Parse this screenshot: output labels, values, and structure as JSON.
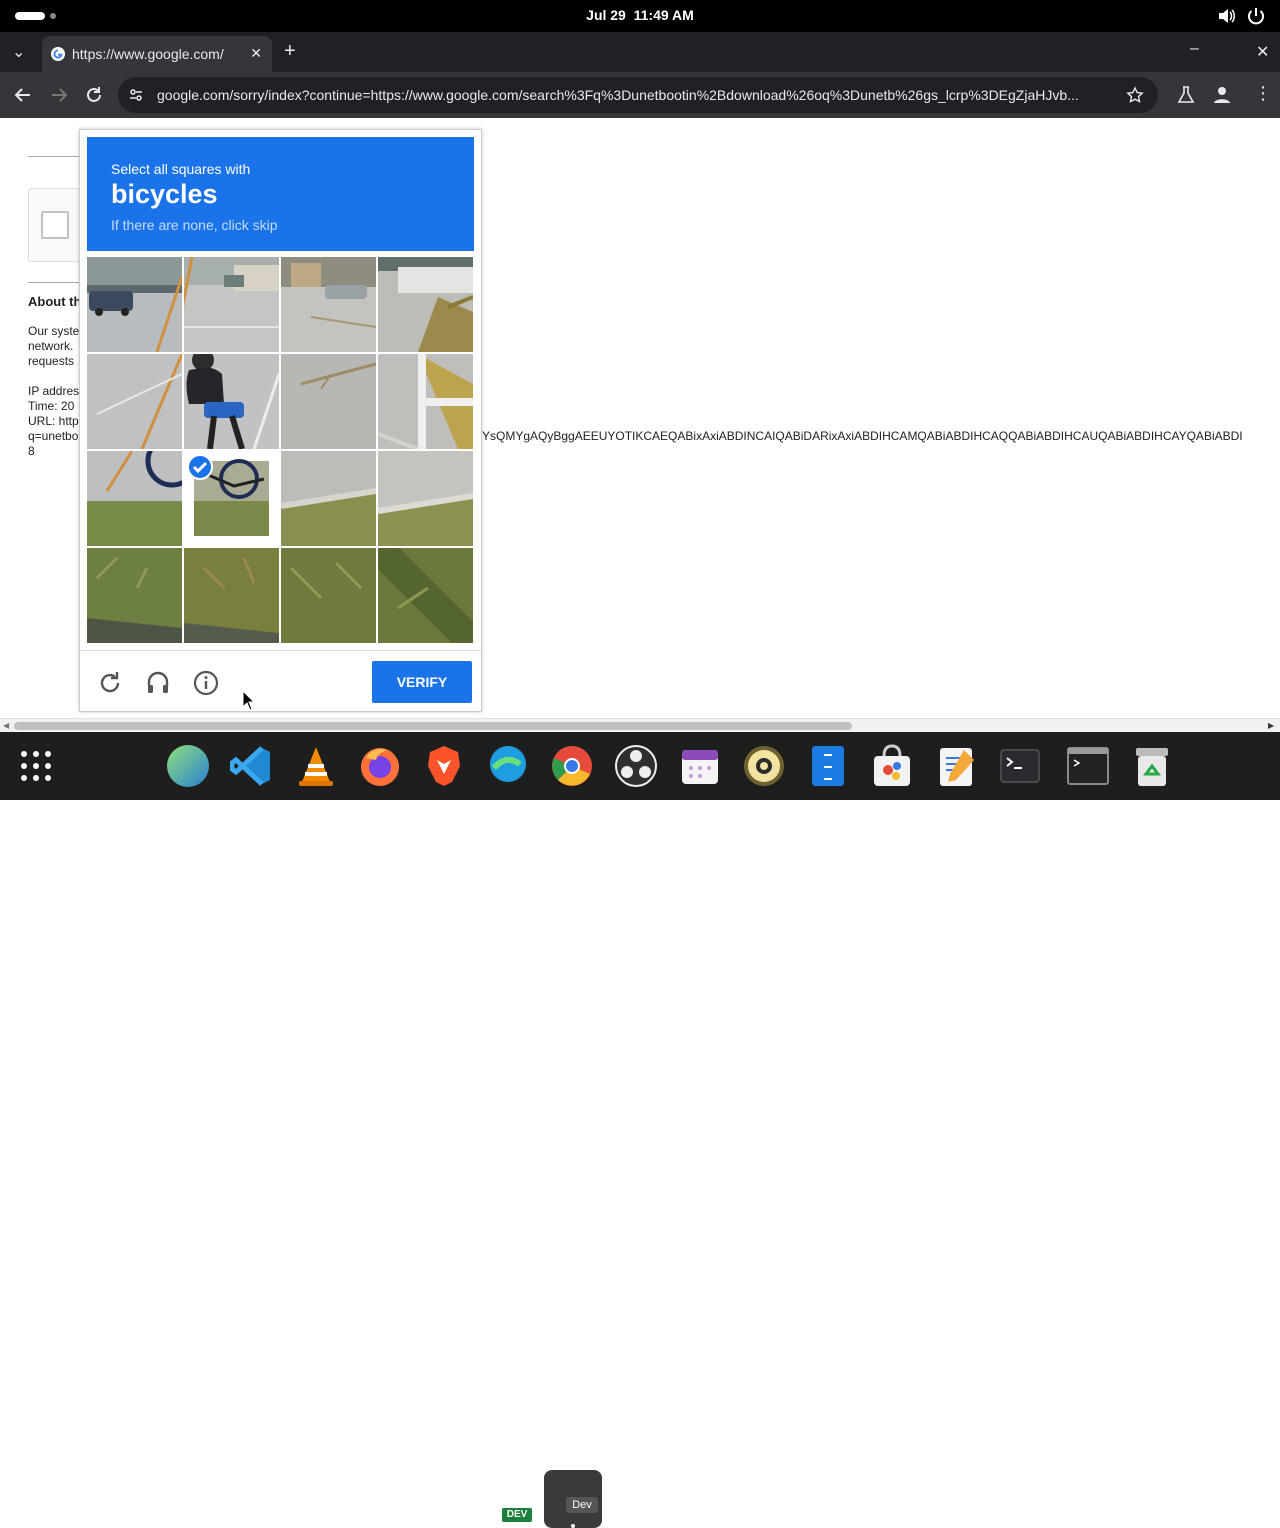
{
  "system": {
    "date": "Jul 29",
    "time": "11:49 AM"
  },
  "browser": {
    "tab_title": "https://www.google.com/",
    "url": "google.com/sorry/index?continue=https://www.google.com/search%3Fq%3Dunetbootin%2Bdownload%26oq%3Dunetb%26gs_lcrp%3DEgZjaHJvb..."
  },
  "page": {
    "about_heading": "About th",
    "para_lines": [
      "Our syste",
      "network.",
      "requests"
    ],
    "ip_label": "IP addres",
    "time_label": "Time: 20",
    "url_label": "URL: http",
    "q_line": "q=unetbo",
    "trailing_digit": "8",
    "long_token": "YsQMYgAQyBggAEEUYOTIKCAEQABixAxiABDINCAIQABiDARixAxiABDIHCAMQABiABDIHCAQQABiABDIHCAUQABiABDIHCAYQABiABDI"
  },
  "captcha": {
    "instruction": "Select all squares with",
    "target": "bicycles",
    "hint": "If there are none, click skip",
    "verify_label": "VERIFY",
    "selected_tiles": [
      5
    ]
  },
  "dock": {
    "chrome_badge": "Dev",
    "edge_badge": "DEV",
    "apps": [
      "app-grid",
      "globe",
      "vscode",
      "vlc",
      "firefox",
      "brave",
      "edge-dev",
      "chrome-dev",
      "obs",
      "calendar",
      "speaker",
      "file-cabinet",
      "store",
      "text-editor",
      "terminal",
      "terminal-2",
      "trash"
    ]
  }
}
